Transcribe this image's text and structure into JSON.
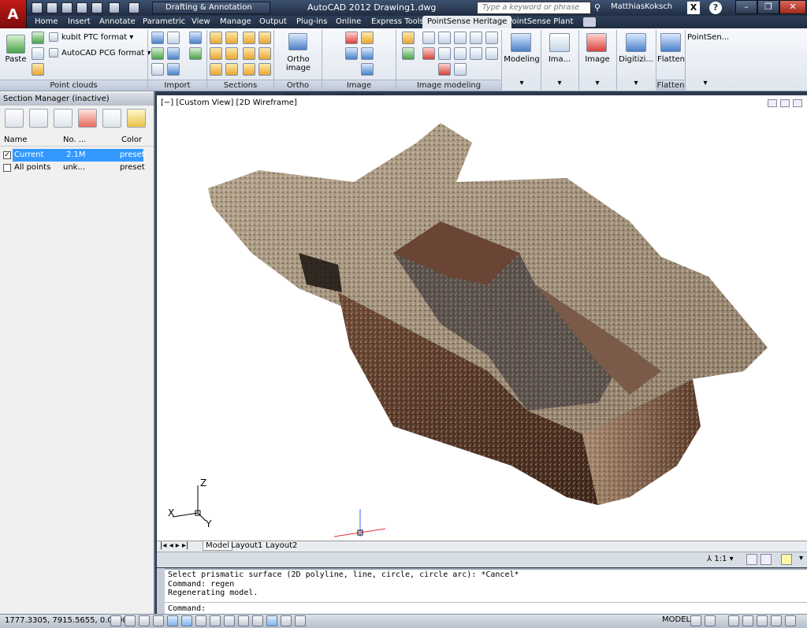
{
  "titlebar": {
    "app_icon": "autocad-app-icon",
    "app_letter": "A",
    "workspace": "Drafting & Annotation",
    "title": "AutoCAD 2012    Drawing1.dwg",
    "search_placeholder": "Type a keyword or phrase",
    "user": "MatthiasKoksch"
  },
  "tabs": [
    "Home",
    "Insert",
    "Annotate",
    "Parametric",
    "View",
    "Manage",
    "Output",
    "Plug-ins",
    "Online",
    "Express Tools",
    "PointSense Heritage",
    "PointSense Plant"
  ],
  "active_tab": "PointSense Heritage",
  "ribbon": {
    "panels": [
      "Point clouds",
      "Import",
      "Sections",
      "Ortho image",
      "Image computation",
      "Image modeling",
      "Flatten"
    ],
    "paste": "Paste",
    "kubit_ptc": "kubit PTC format",
    "acad_pcg": "AutoCAD PCG format",
    "ortho_image": "Ortho image",
    "modeling": "Modeling",
    "ima": "Ima...",
    "image": "Image",
    "digitizi": "Digitizi...",
    "flatten": "Flatten",
    "pointsen": "PointSen..."
  },
  "section_manager": {
    "title": "Section Manager (inactive)",
    "columns": [
      "Name",
      "No. ...",
      "Color"
    ],
    "rows": [
      {
        "checked": "✓",
        "name": "Current",
        "no": "2.1M",
        "color": "preset",
        "selected": true
      },
      {
        "checked": "",
        "name": "All points",
        "no": "unk...",
        "color": "preset",
        "selected": false
      }
    ]
  },
  "viewport": {
    "label": "[−] [Custom View] [2D Wireframe]",
    "axis_x": "X",
    "axis_y": "Y",
    "axis_z": "Z"
  },
  "layout_tabs": [
    "Model",
    "Layout1",
    "Layout2"
  ],
  "vp_status": {
    "scale": "1:1"
  },
  "command": {
    "lines": [
      "Select prismatic surface (2D polyline, line, circle, circle arc): *Cancel*",
      "Command: regen",
      "Regenerating model."
    ],
    "prompt": "Command:"
  },
  "statusbar": {
    "coords": "1777.3305, 7915.5655, 0.0000",
    "model": "MODEL"
  },
  "colors": {
    "accent": "#3399ff",
    "title_bg": "#1f2d42",
    "ribbon_bg": "#dfe5ee"
  }
}
